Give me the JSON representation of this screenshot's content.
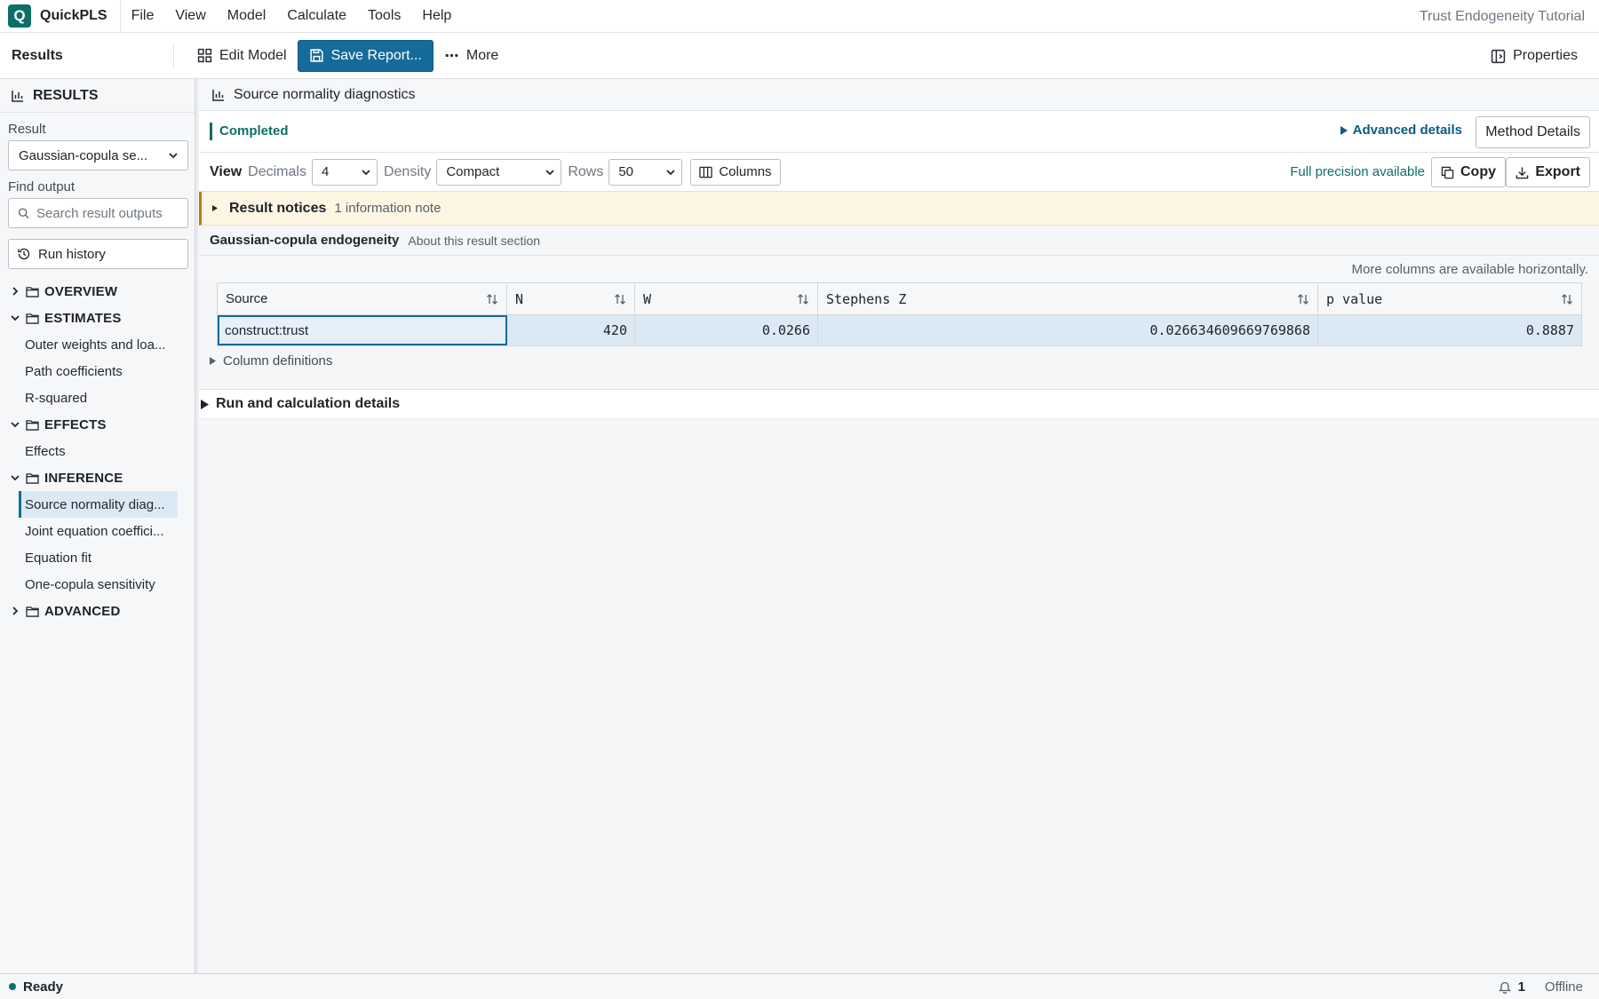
{
  "app": {
    "name": "QuickPLS",
    "window_title": "Trust Endogeneity Tutorial",
    "menu": [
      "File",
      "View",
      "Model",
      "Calculate",
      "Tools",
      "Help"
    ]
  },
  "toolbar": {
    "title": "Results",
    "edit_model": "Edit Model",
    "save_report": "Save Report...",
    "more": "More",
    "properties": "Properties"
  },
  "sidebar": {
    "header": "RESULTS",
    "result_label": "Result",
    "result_value": "Gaussian-copula se...",
    "find_label": "Find output",
    "search_placeholder": "Search result outputs",
    "run_history": "Run history",
    "groups": {
      "overview": "OVERVIEW",
      "estimates": "ESTIMATES",
      "effects": "EFFECTS",
      "inference": "INFERENCE",
      "advanced": "ADVANCED"
    },
    "items": {
      "outer_weights": "Outer weights and loa...",
      "path_coefficients": "Path coefficients",
      "r_squared": "R-squared",
      "effects": "Effects",
      "source_normality": "Source normality diag...",
      "joint_equation": "Joint equation coeffici...",
      "equation_fit": "Equation fit",
      "one_copula": "One-copula sensitivity"
    }
  },
  "main": {
    "title": "Source normality diagnostics",
    "status": "Completed",
    "advanced_details": "Advanced details",
    "method_details": "Method Details",
    "view": {
      "label": "View",
      "decimals_label": "Decimals",
      "decimals_value": "4",
      "density_label": "Density",
      "density_value": "Compact",
      "rows_label": "Rows",
      "rows_value": "50",
      "columns": "Columns",
      "full_precision": "Full precision available",
      "copy": "Copy",
      "export": "Export"
    },
    "notice": {
      "title": "Result notices",
      "subtitle": "1 information note"
    },
    "section": {
      "title": "Gaussian-copula endogeneity",
      "link": "About this result section"
    },
    "more_columns": "More columns are available horizontally.",
    "table": {
      "headers": [
        "Source",
        "N",
        "W",
        "Stephens Z",
        "p value"
      ],
      "rows": [
        [
          "construct:trust",
          "420",
          "0.0266",
          "0.026634609669769868",
          "0.8887"
        ]
      ]
    },
    "column_definitions": "Column definitions",
    "run_details": "Run and calculation details"
  },
  "statusbar": {
    "status": "Ready",
    "notifications": "1",
    "connection": "Offline"
  },
  "colors": {
    "accent": "#156b9a",
    "brand": "#0e6e66",
    "notice": "#fdf6e3"
  }
}
